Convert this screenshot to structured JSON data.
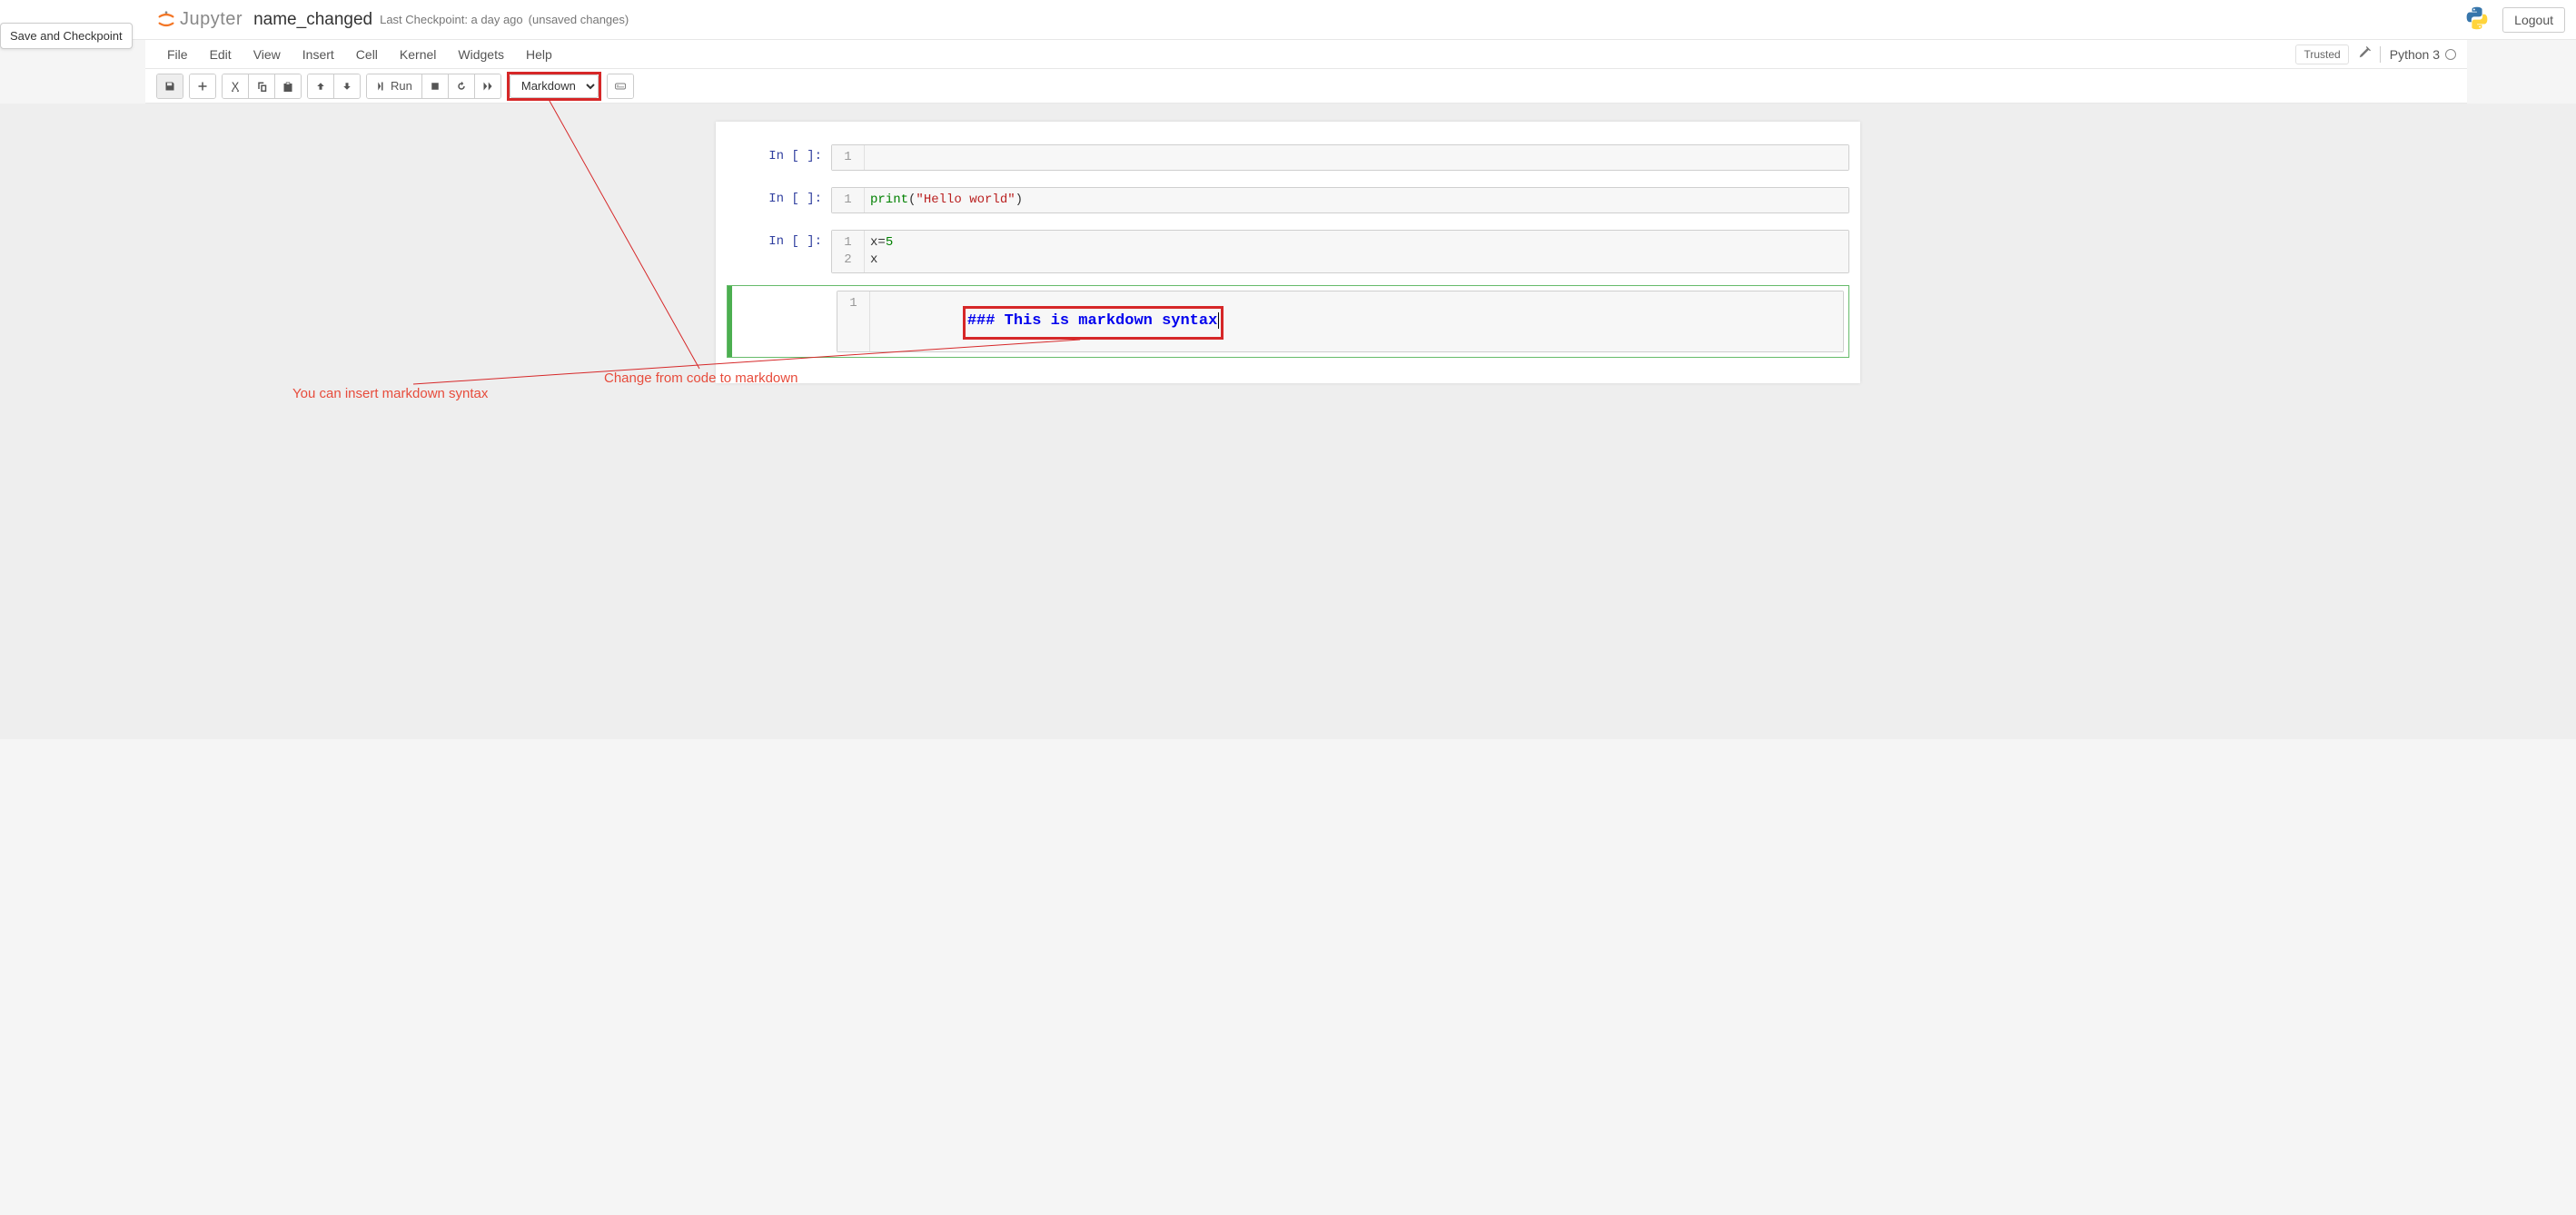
{
  "tooltip": "Save and Checkpoint",
  "header": {
    "logo_text": "Jupyter",
    "notebook_title": "name_changed",
    "checkpoint": "Last Checkpoint: a day ago",
    "unsaved": "(unsaved changes)",
    "logout": "Logout"
  },
  "menu": {
    "items": [
      "File",
      "Edit",
      "View",
      "Insert",
      "Cell",
      "Kernel",
      "Widgets",
      "Help"
    ],
    "trusted": "Trusted",
    "kernel": "Python 3"
  },
  "toolbar": {
    "run_label": "Run",
    "cell_type": "Markdown"
  },
  "cells": [
    {
      "prompt": "In [ ]:",
      "lines": [
        "1"
      ],
      "code_html": " "
    },
    {
      "prompt": "In [ ]:",
      "lines": [
        "1"
      ],
      "tokens": [
        {
          "t": "builtin",
          "v": "print"
        },
        {
          "t": "punct",
          "v": "("
        },
        {
          "t": "string",
          "v": "\"Hello world\""
        },
        {
          "t": "punct",
          "v": ")"
        }
      ]
    },
    {
      "prompt": "In [ ]:",
      "lines": [
        "1",
        "2"
      ],
      "rows": [
        [
          {
            "t": "var",
            "v": "x"
          },
          {
            "t": "punct",
            "v": "="
          },
          {
            "t": "num",
            "v": "5"
          }
        ],
        [
          {
            "t": "var",
            "v": "x"
          }
        ]
      ]
    },
    {
      "prompt": "",
      "lines": [
        "1"
      ],
      "markdown": "### This is markdown syntax",
      "selected": true
    }
  ],
  "annotations": {
    "left": "You can insert markdown syntax",
    "right": "Change from code to markdown"
  }
}
